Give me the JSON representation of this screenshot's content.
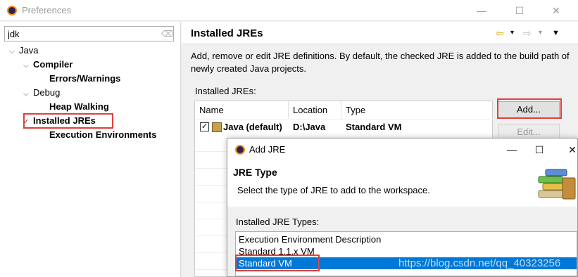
{
  "window": {
    "title": "Preferences",
    "minimize": "—",
    "maximize": "☐",
    "close": "✕"
  },
  "filter": {
    "value": "jdk",
    "clear_icon": "eraser-icon"
  },
  "tree": {
    "java": "Java",
    "compiler": "Compiler",
    "errors_warnings": "Errors/Warnings",
    "debug": "Debug",
    "heap_walking": "Heap Walking",
    "installed_jres": "Installed JREs",
    "execution_environments": "Execution Environments",
    "expanded_glyph": "⌵",
    "selected_glyph": "✓"
  },
  "page": {
    "title": "Installed JREs",
    "back_icon": "⇦",
    "forward_icon": "⇨",
    "dropdown_icon": "▾",
    "menu_icon": "▼",
    "description": "Add, remove or edit JRE definitions. By default, the checked JRE is added to the build path of newly created Java projects.",
    "list_label": "Installed JREs:"
  },
  "jre_table": {
    "columns": [
      "Name",
      "Location",
      "Type"
    ],
    "rows": [
      {
        "checked": true,
        "name": "Java (default)",
        "location": "D:\\Java",
        "type": "Standard VM"
      }
    ]
  },
  "buttons": {
    "add": "Add...",
    "edit": "Edit..."
  },
  "dialog": {
    "title": "Add JRE",
    "header_title": "JRE Type",
    "header_desc": "Select the type of JRE to add to the workspace.",
    "types_label": "Installed JRE Types:",
    "types": [
      "Execution Environment Description",
      "Standard 1.1.x VM",
      "Standard VM"
    ],
    "selected_index": 2,
    "minimize": "—",
    "maximize": "☐",
    "close": "✕"
  },
  "watermark": "https://blog.csdn.net/qq_40323256",
  "colors": {
    "highlight_box": "#e0403a",
    "selection": "#0078d7"
  }
}
